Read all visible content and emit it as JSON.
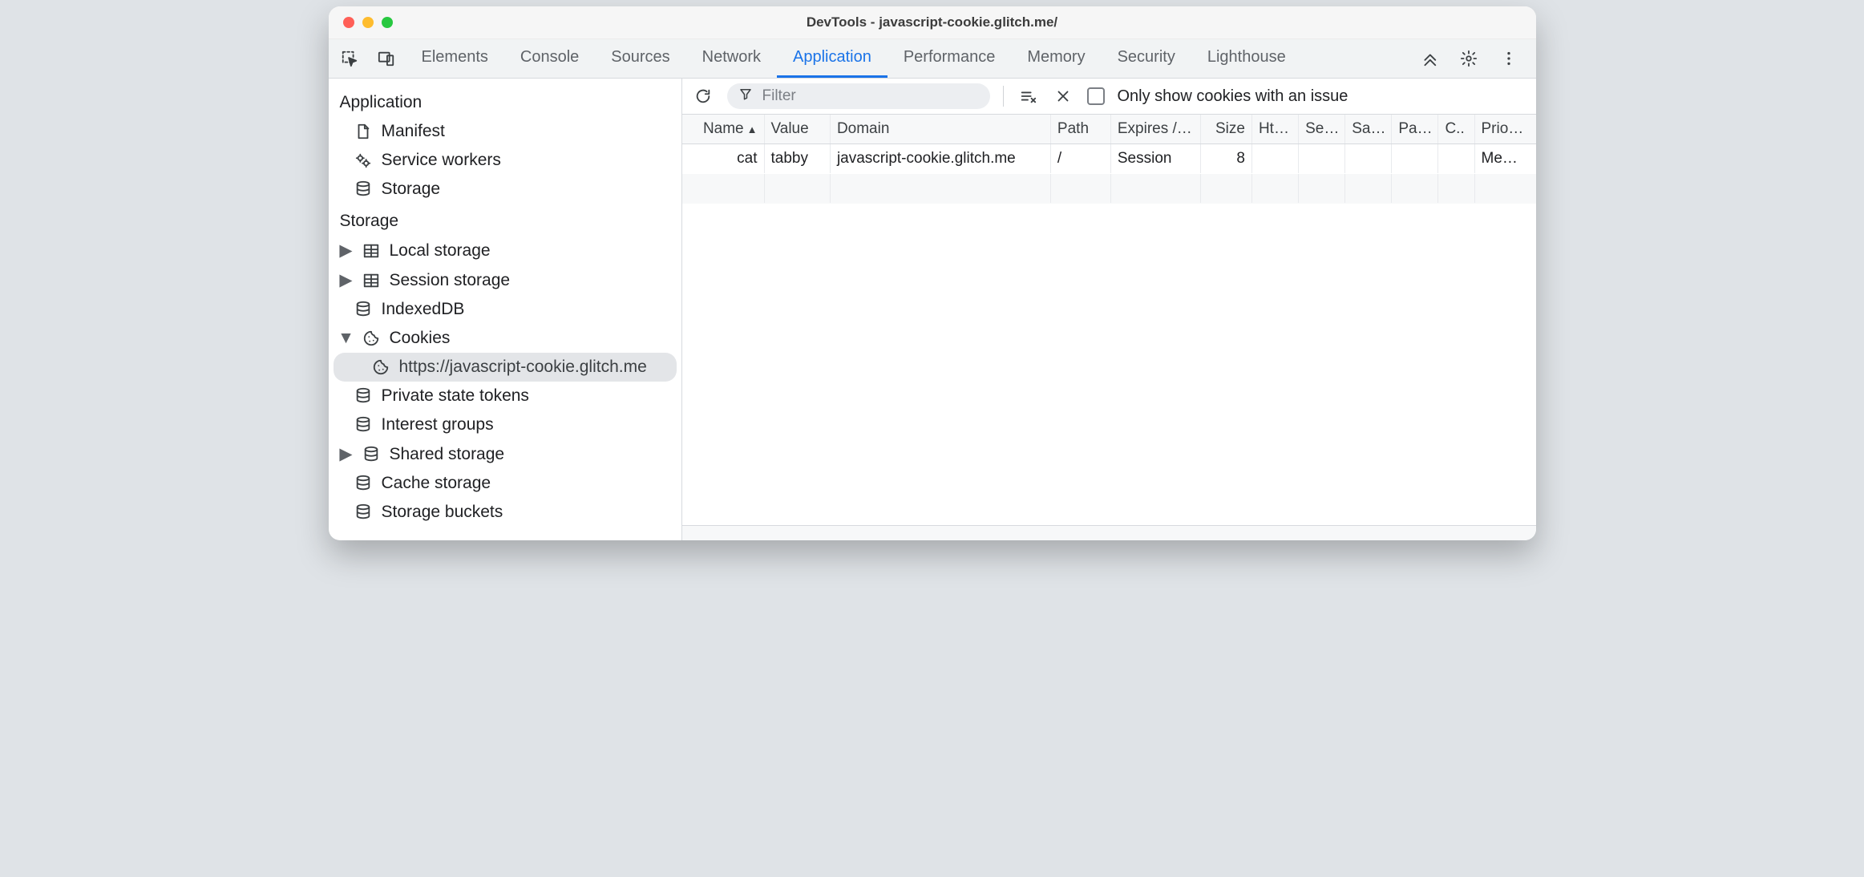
{
  "window": {
    "title": "DevTools - javascript-cookie.glitch.me/"
  },
  "tabbar": {
    "tabs": [
      "Elements",
      "Console",
      "Sources",
      "Network",
      "Application",
      "Performance",
      "Memory",
      "Security",
      "Lighthouse"
    ],
    "activeIndex": 4
  },
  "sidebar": {
    "sections": [
      {
        "header": "Application",
        "items": [
          {
            "label": "Manifest",
            "icon": "file"
          },
          {
            "label": "Service workers",
            "icon": "gears"
          },
          {
            "label": "Storage",
            "icon": "db"
          }
        ]
      },
      {
        "header": "Storage",
        "items": [
          {
            "label": "Local storage",
            "icon": "table",
            "expandable": true,
            "expanded": false
          },
          {
            "label": "Session storage",
            "icon": "table",
            "expandable": true,
            "expanded": false
          },
          {
            "label": "IndexedDB",
            "icon": "db"
          },
          {
            "label": "Cookies",
            "icon": "cookie",
            "expandable": true,
            "expanded": true,
            "children": [
              {
                "label": "https://javascript-cookie.glitch.me",
                "icon": "cookie",
                "selected": true
              }
            ]
          },
          {
            "label": "Private state tokens",
            "icon": "db"
          },
          {
            "label": "Interest groups",
            "icon": "db"
          },
          {
            "label": "Shared storage",
            "icon": "db",
            "expandable": true,
            "expanded": false
          },
          {
            "label": "Cache storage",
            "icon": "db"
          },
          {
            "label": "Storage buckets",
            "icon": "db"
          }
        ]
      }
    ]
  },
  "toolbar": {
    "filter_placeholder": "Filter",
    "only_issues_label": "Only show cookies with an issue",
    "only_issues_checked": false
  },
  "table": {
    "columns": [
      {
        "key": "name",
        "label": "Name",
        "sorted": "asc"
      },
      {
        "key": "value",
        "label": "Value"
      },
      {
        "key": "domain",
        "label": "Domain"
      },
      {
        "key": "path",
        "label": "Path"
      },
      {
        "key": "expires",
        "label": "Expires /…"
      },
      {
        "key": "size",
        "label": "Size"
      },
      {
        "key": "httponly",
        "label": "Ht…"
      },
      {
        "key": "secure",
        "label": "Se…"
      },
      {
        "key": "samesite",
        "label": "Sa…"
      },
      {
        "key": "partition",
        "label": "Pa…"
      },
      {
        "key": "cross",
        "label": "C.."
      },
      {
        "key": "priority",
        "label": "Prio…"
      }
    ],
    "rows": [
      {
        "name": "cat",
        "value": "tabby",
        "domain": "javascript-cookie.glitch.me",
        "path": "/",
        "expires": "Session",
        "size": "8",
        "httponly": "",
        "secure": "",
        "samesite": "",
        "partition": "",
        "cross": "",
        "priority": "Me…"
      }
    ]
  }
}
